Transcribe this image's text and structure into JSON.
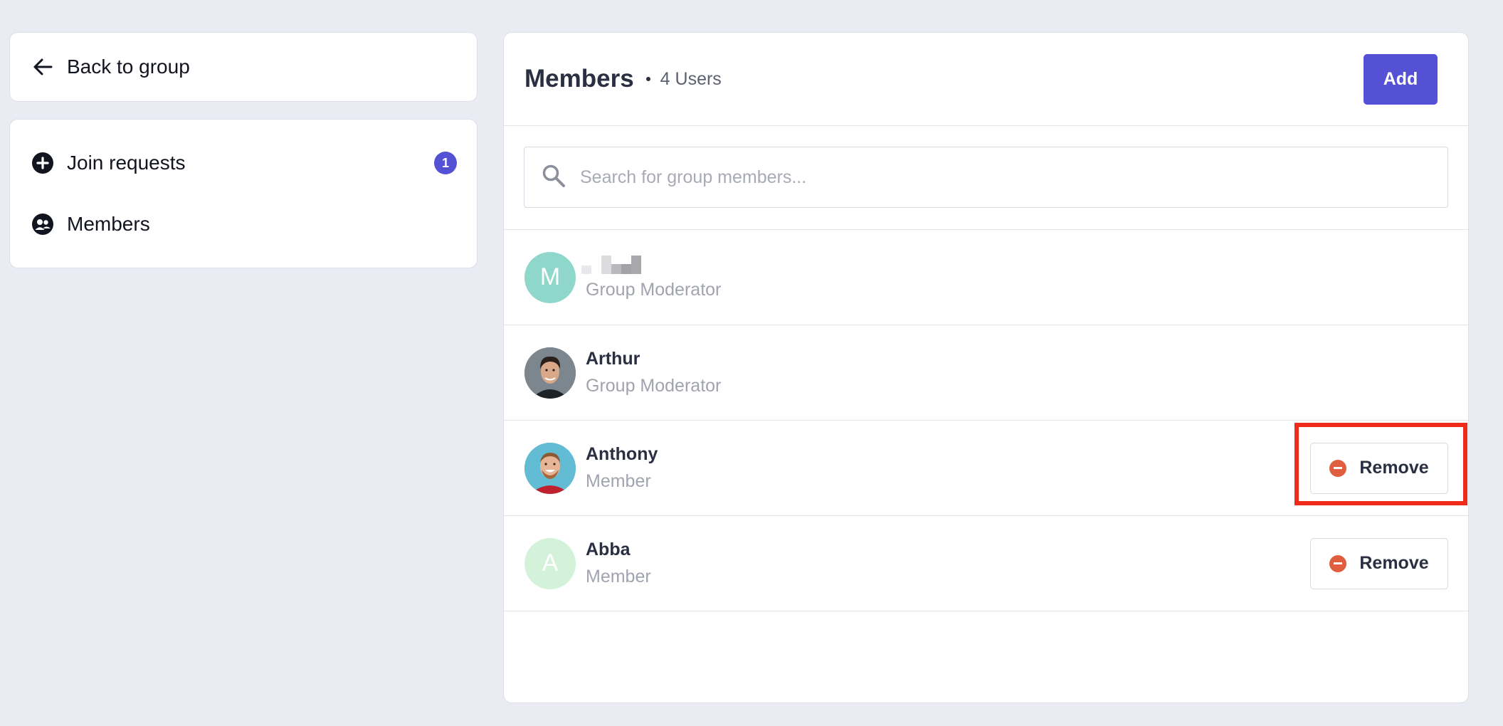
{
  "sidebar": {
    "back_label": "Back to group",
    "items": [
      {
        "label": "Join requests",
        "icon": "plus-circle-icon",
        "badge": "1"
      },
      {
        "label": "Members",
        "icon": "members-icon"
      }
    ]
  },
  "main": {
    "title": "Members",
    "user_count": "4 Users",
    "add_label": "Add",
    "search_placeholder": "Search for group members..."
  },
  "members": [
    {
      "name": "",
      "role": "Group Moderator",
      "avatar_initial": "M",
      "avatar_color": "#8fd6cb"
    },
    {
      "name": "Arthur",
      "role": "Group Moderator",
      "avatar": "photo"
    },
    {
      "name": "Anthony",
      "role": "Member",
      "avatar": "photo",
      "action": "Remove"
    },
    {
      "name": "Abba",
      "role": "Member",
      "avatar_initial": "A",
      "avatar_color": "#d4f2d9",
      "action": "Remove"
    }
  ],
  "colors": {
    "accent": "#5551d4",
    "remove": "#e05d3f",
    "highlight": "#ee2a1b"
  }
}
